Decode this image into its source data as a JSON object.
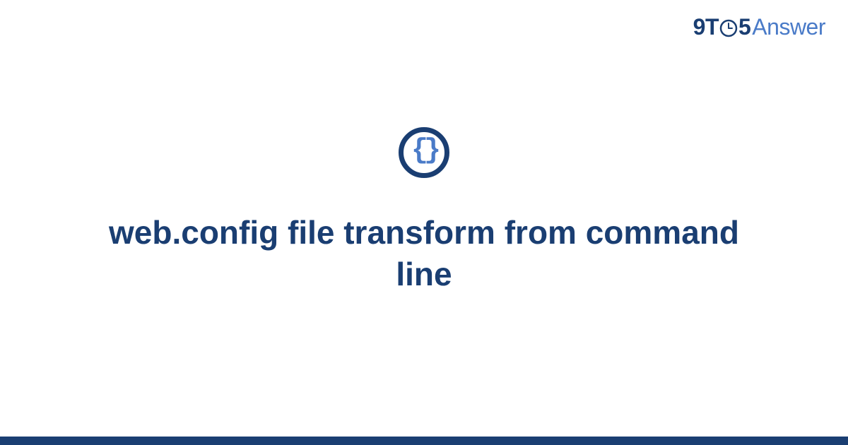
{
  "logo": {
    "nine": "9",
    "t": "T",
    "five": "5",
    "answer": "Answer"
  },
  "icon": {
    "braces": "{}"
  },
  "heading": "web.config file transform from command line",
  "colors": {
    "dark_blue": "#1a3e72",
    "light_blue": "#4a7bc8"
  }
}
